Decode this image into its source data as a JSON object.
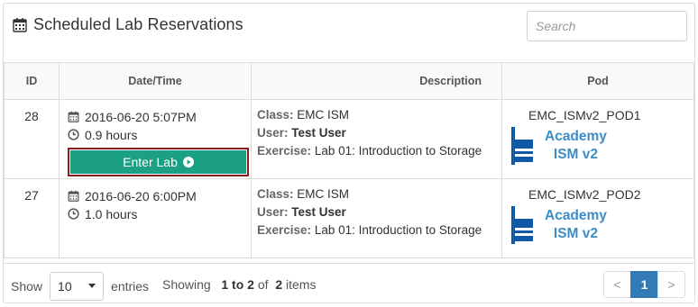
{
  "header": {
    "title": "Scheduled Lab Reservations",
    "icon": "calendar-icon"
  },
  "search": {
    "placeholder": "Search",
    "value": ""
  },
  "table": {
    "columns": [
      "ID",
      "Date/Time",
      "Description",
      "Pod"
    ],
    "rows": [
      {
        "id": "28",
        "datetime": "2016-06-20 5:07PM",
        "duration": "0.9 hours",
        "action": "Enter Lab",
        "class_label": "Class:",
        "class_value": "EMC ISM",
        "user_label": "User:",
        "user_value": "Test User",
        "exercise_label": "Exercise:",
        "exercise_value": "Lab 01: Introduction to Storage",
        "pod": "EMC_ISMv2_POD1",
        "pod_brand_line1": "Academy",
        "pod_brand_line2": "ISM v2"
      },
      {
        "id": "27",
        "datetime": "2016-06-20 6:00PM",
        "duration": "1.0 hours",
        "class_label": "Class:",
        "class_value": "EMC ISM",
        "user_label": "User:",
        "user_value": "Test User",
        "exercise_label": "Exercise:",
        "exercise_value": "Lab 01: Introduction to Storage",
        "pod": "EMC_ISMv2_POD2",
        "pod_brand_line1": "Academy",
        "pod_brand_line2": "ISM v2"
      }
    ]
  },
  "footer": {
    "show_label": "Show",
    "entries_value": "10",
    "entries_label": "entries",
    "showing_prefix": "Showing",
    "showing_range": "1 to 2",
    "showing_of": "of",
    "showing_total": "2",
    "showing_suffix": "items",
    "pager": {
      "prev": "<",
      "current": "1",
      "next": ">"
    }
  },
  "colors": {
    "enter_button": "#1ba083",
    "enter_highlight": "#8b1a1a",
    "brand_blue": "#3c8dc6",
    "pager_active": "#337ab7"
  }
}
